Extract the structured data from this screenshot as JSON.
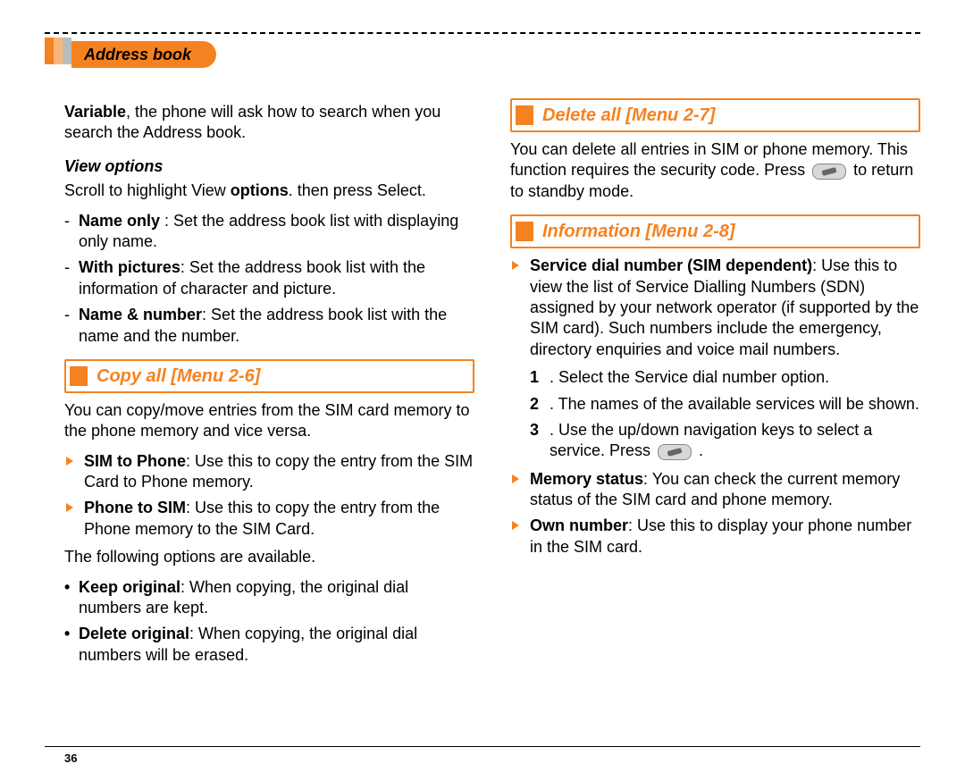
{
  "header": {
    "title": "Address book"
  },
  "pageNumber": "36",
  "left": {
    "intro": {
      "bold": "Variable",
      "rest": ", the phone will ask how to search when you search the Address book."
    },
    "viewOptions": {
      "heading": "View options",
      "lead_pre": "Scroll to highlight View ",
      "lead_bold": "options",
      "lead_post": ". then press Select.",
      "items": [
        {
          "bold": "Name only",
          "rest": " : Set the address book list with displaying only name."
        },
        {
          "bold": "With pictures",
          "rest": ": Set the address book list with the information of character and picture."
        },
        {
          "bold": "Name & number",
          "rest": ": Set the  address book list with the name and the number."
        }
      ]
    },
    "copyAll": {
      "title": "Copy all [Menu 2-6]",
      "lead": "You can copy/move entries from the SIM card memory to the phone memory and vice versa.",
      "arrows": [
        {
          "bold": "SIM to Phone",
          "rest": ": Use this to copy the entry from the SIM Card to Phone memory."
        },
        {
          "bold": "Phone to SIM",
          "rest": ": Use this to copy the entry from the Phone memory to the SIM Card."
        }
      ],
      "optsLead": "The following options are available.",
      "bullets": [
        {
          "bold": "Keep original",
          "rest": ": When copying, the original dial numbers are kept."
        },
        {
          "bold": "Delete original",
          "rest": ": When copying, the original dial numbers will be erased."
        }
      ]
    }
  },
  "right": {
    "deleteAll": {
      "title": "Delete all [Menu 2-7]",
      "lead_pre": "You can delete all entries in SIM or phone memory. This function requires the security code. Press ",
      "lead_post": " to return to standby mode."
    },
    "information": {
      "title": "Information [Menu 2-8]",
      "sdn": {
        "bold": "Service dial number (SIM dependent)",
        "rest": ": Use this to view the list of Service Dialling Numbers (SDN) assigned by your network operator (if supported by the SIM card). Such numbers include the emergency, directory enquiries and voice mail numbers."
      },
      "steps": [
        {
          "n": "1",
          "text": ". Select the Service dial number option."
        },
        {
          "n": "2",
          "text": ". The names of the available services will be shown."
        },
        {
          "n": "3",
          "pre": ". Use the up/down navigation keys to select a service. Press ",
          "post": " ."
        }
      ],
      "arrows": [
        {
          "bold": "Memory status",
          "rest": ": You can check the current memory status of the SIM card and phone memory."
        },
        {
          "bold": "Own number",
          "rest": ": Use this to display your phone number in the SIM card."
        }
      ]
    }
  }
}
